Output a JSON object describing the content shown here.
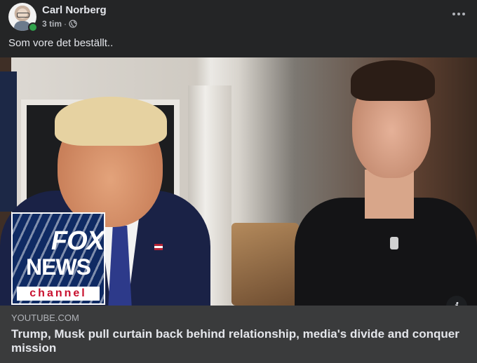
{
  "post": {
    "author": "Carl Norberg",
    "time": "3 tim",
    "separator": "·",
    "caption": "Som vore det beställt..",
    "online": true
  },
  "icons": {
    "more": "more-horizontal-icon",
    "audience": "globe-icon",
    "info": "info-icon"
  },
  "media": {
    "logo": {
      "word1": "FOX",
      "word2": "NEWS",
      "sub": "channel"
    }
  },
  "link": {
    "domain": "YOUTUBE.COM",
    "title": "Trump, Musk pull curtain back behind relationship, media's divide and conquer mission"
  },
  "colors": {
    "background": "#242526",
    "link_box": "#3a3b3c",
    "text_primary": "#e4e6eb",
    "text_secondary": "#b0b3b8",
    "online": "#31a24c"
  }
}
